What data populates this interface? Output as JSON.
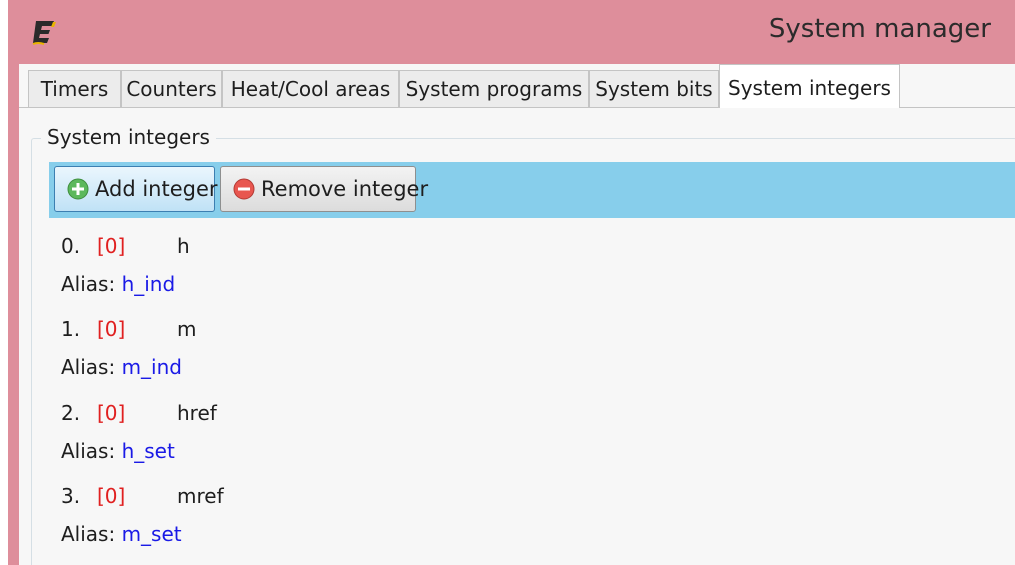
{
  "window": {
    "title": "System manager"
  },
  "tabs": [
    {
      "label": "Timers",
      "selected": false
    },
    {
      "label": "Counters",
      "selected": false
    },
    {
      "label": "Heat/Cool areas",
      "selected": false
    },
    {
      "label": "System programs",
      "selected": false
    },
    {
      "label": "System bits",
      "selected": false
    },
    {
      "label": "System integers",
      "selected": true
    }
  ],
  "group": {
    "label": "System integers"
  },
  "toolbar": {
    "add_label": "Add integer",
    "remove_label": "Remove integer",
    "add_icon": "plus-circle-green",
    "remove_icon": "minus-circle-red"
  },
  "alias_prefix": "Alias:",
  "integers": [
    {
      "index": "0.",
      "value": "[0]",
      "name": "h",
      "alias": "h_ind"
    },
    {
      "index": "1.",
      "value": "[0]",
      "name": "m",
      "alias": "m_ind"
    },
    {
      "index": "2.",
      "value": "[0]",
      "name": "href",
      "alias": "h_set"
    },
    {
      "index": "3.",
      "value": "[0]",
      "name": "mref",
      "alias": "m_set"
    }
  ],
  "colors": {
    "title_bar": "#de8e9b",
    "toolbar": "#87ceeb",
    "value_text": "#e02020",
    "alias_text": "#1a1ae6"
  }
}
